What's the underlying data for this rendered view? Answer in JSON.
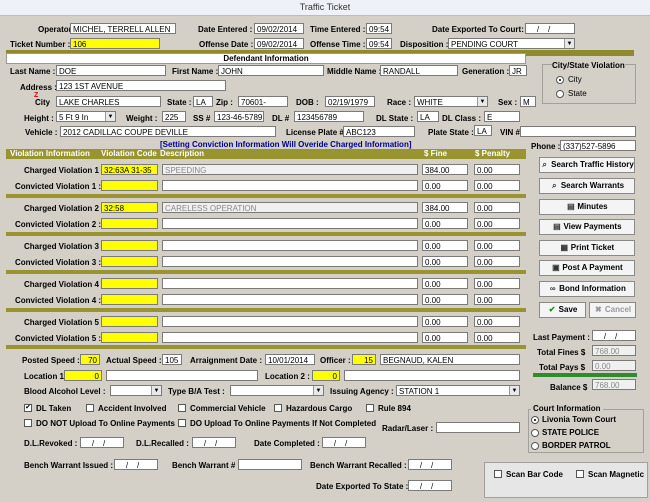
{
  "window": {
    "title": "Traffic Ticket"
  },
  "header": {
    "operator_label": "Operator :",
    "operator": "MICHEL, TERRELL ALLEN",
    "date_entered_label": "Date Entered :",
    "date_entered": "09/02/2014",
    "time_entered_label": "Time Entered :",
    "time_entered": "09:54",
    "date_exported_label": "Date Exported To Court:",
    "date_exported": "__/__/____",
    "ticket_number_label": "Ticket Number :",
    "ticket_number": "106",
    "offense_date_label": "Offense Date :",
    "offense_date": "09/02/2014",
    "offense_time_label": "Offense Time :",
    "offense_time": "09:54",
    "disposition_label": "Disposition :",
    "disposition": "PENDING COURT"
  },
  "defendant": {
    "section_title": "Defendant Information",
    "last_name_label": "Last Name :",
    "last_name": "DOE",
    "first_name_label": "First Name :",
    "first_name": "JOHN",
    "middle_name_label": "Middle Name :",
    "middle_name": "RANDALL",
    "generation_label": "Generation :",
    "generation": "JR",
    "address_label": "Address :",
    "address": "123 1ST AVENUE",
    "city_label": "City",
    "city": "LAKE CHARLES",
    "state_label": "State :",
    "state": "LA",
    "zip_label": "Zip :",
    "zip": "70601-____",
    "dob_label": "DOB :",
    "dob": "02/19/1979",
    "race_label": "Race :",
    "race": "WHITE",
    "sex_label": "Sex :",
    "sex": "M",
    "height_label": "Height :",
    "height": "5 Ft 9 In",
    "weight_label": "Weight :",
    "weight": "225",
    "ssn_label": "SS #",
    "ssn": "123-46-5789",
    "dl_label": "DL #",
    "dl": "123456789",
    "dl_state_label": "DL State :",
    "dl_state": "LA",
    "dl_class_label": "DL Class :",
    "dl_class": "E",
    "vehicle_label": "Vehicle :",
    "vehicle": "2012 CADILLAC COUPE DEVILLE",
    "license_plate_label": "License Plate #",
    "license_plate": "ABC123",
    "plate_state_label": "Plate State :",
    "plate_state": "LA",
    "vin_label": "VIN #",
    "vin": "",
    "phone_label": "Phone :",
    "phone": "(337)527-5896",
    "city_state_violation_title": "City/State Violation",
    "city_option": "City",
    "state_option": "State"
  },
  "violations": {
    "notice": "[Setting Conviction Information Will Overide Charged Information]",
    "col_info": "Violation Information",
    "col_code": "Violation Code",
    "col_desc": "Description",
    "col_fine": "$ Fine",
    "col_penalty": "$ Penalty",
    "rows": [
      {
        "charged_label": "Charged Violation 1 :",
        "charged_code": "32:63A 31-35",
        "charged_desc": "SPEEDING",
        "charged_fine": "384.00",
        "charged_penalty": "0.00",
        "convicted_label": "Convicted Violation 1 :",
        "convicted_fine": "0.00",
        "convicted_penalty": "0.00"
      },
      {
        "charged_label": "Charged Violation 2 :",
        "charged_code": "32:58",
        "charged_desc": "CARELESS OPERATION",
        "charged_fine": "384.00",
        "charged_penalty": "0.00",
        "convicted_label": "Convicted Violation 2 :",
        "convicted_fine": "0.00",
        "convicted_penalty": "0.00"
      },
      {
        "charged_label": "Charged Violation 3 :",
        "charged_code": "",
        "charged_desc": "",
        "charged_fine": "0.00",
        "charged_penalty": "0.00",
        "convicted_label": "Convicted Violation 3 :",
        "convicted_fine": "0.00",
        "convicted_penalty": "0.00"
      },
      {
        "charged_label": "Charged Violation 4 :",
        "charged_code": "",
        "charged_desc": "",
        "charged_fine": "0.00",
        "charged_penalty": "0.00",
        "convicted_label": "Convicted Violation 4 :",
        "convicted_fine": "0.00",
        "convicted_penalty": "0.00"
      },
      {
        "charged_label": "Charged Violation 5 :",
        "charged_code": "",
        "charged_desc": "",
        "charged_fine": "0.00",
        "charged_penalty": "0.00",
        "convicted_label": "Convicted Violation 5 :",
        "convicted_fine": "0.00",
        "convicted_penalty": "0.00"
      }
    ]
  },
  "actions": {
    "search_history": "Search Traffic History",
    "search_warrants": "Search Warrants",
    "minutes": "Minutes",
    "view_payments": "View Payments",
    "print_ticket": "Print Ticket",
    "post_payment": "Post A Payment",
    "bond_info": "Bond Information",
    "save": "Save",
    "cancel": "Cancel"
  },
  "payments": {
    "last_payment_label": "Last Payment :",
    "last_payment": "__/__/____",
    "total_fines_label": "Total Fines $",
    "total_fines": "768.00",
    "total_pays_label": "Total Pays $",
    "total_pays": "0.00",
    "balance_label": "Balance $",
    "balance": "768.00"
  },
  "details": {
    "posted_speed_label": "Posted Speed :",
    "posted_speed": "70",
    "actual_speed_label": "Actual Speed :",
    "actual_speed": "105",
    "arraignment_label": "Arraignment Date :",
    "arraignment": "10/01/2014",
    "officer_label": "Officer :",
    "officer_num": "15",
    "officer_name": "BEGNAUD, KALEN",
    "location1_label": "Location 1 :",
    "location1_num": "0",
    "location2_label": "Location 2 :",
    "location2_num": "0",
    "bac_label": "Blood Alcohol Level :",
    "ba_test_label": "Type B/A Test :",
    "agency_label": "Issuing Agency :",
    "agency": "STATION 1",
    "dl_taken": "DL Taken",
    "accident": "Accident Involved",
    "commercial": "Commercial Vehicle",
    "hazmat": "Hazardous Cargo",
    "rule894": "Rule 894",
    "no_upload": "DO NOT Upload To Online Payments",
    "upload_if_not_completed": "DO Upload To Online Payments If Not Completed",
    "radar_label": "Radar/Laser :",
    "dl_revoked_label": "D.L.Revoked :",
    "dl_revoked": "__/__/____",
    "dl_recalled_label": "D.L.Recalled :",
    "dl_recalled": "__/__/____",
    "date_completed_label": "Date Completed :",
    "date_completed": "__/__/____",
    "bw_issued_label": "Bench Warrant Issued :",
    "bw_issued": "__/__/____",
    "bw_num_label": "Bench Warrant #",
    "bw_recalled_label": "Bench Warrant Recalled :",
    "bw_recalled": "__/__/____",
    "exported_state_label": "Date Exported To State :",
    "exported_state": "__/__/____"
  },
  "court": {
    "title": "Court Information",
    "options": [
      "Livonia Town Court",
      "STATE POLICE",
      "BORDER PATROL"
    ]
  },
  "scan": {
    "barcode": "Scan Bar Code",
    "magnetic": "Scan Magnetic"
  }
}
